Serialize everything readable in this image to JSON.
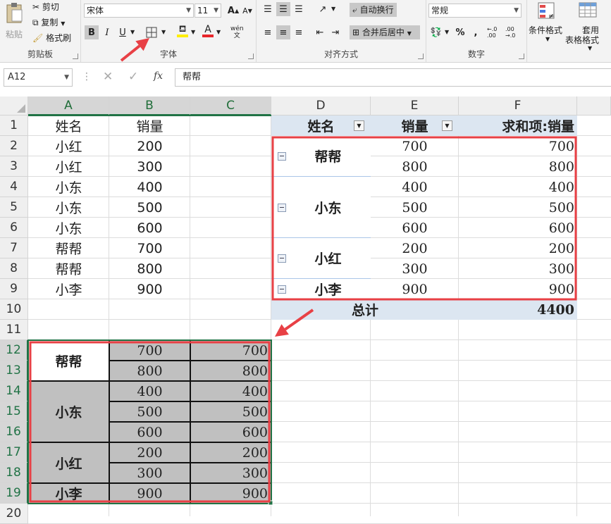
{
  "ribbon": {
    "clipboard": {
      "paste": "粘贴",
      "cut": "剪切",
      "copy": "复制",
      "format_painter": "格式刷",
      "label": "剪贴板"
    },
    "font": {
      "font_name": "宋体",
      "font_size": "11",
      "bold": "B",
      "italic": "I",
      "underline": "U",
      "grow": "A",
      "shrink": "A",
      "phonetic": "wén",
      "label": "字体"
    },
    "alignment": {
      "wrap": "自动换行",
      "merge": "合并后居中",
      "label": "对齐方式"
    },
    "number": {
      "format": "常规",
      "percent": "%",
      "comma": ",",
      "inc": "←.0 .00",
      "dec": ".00 →.0",
      "label": "数字"
    },
    "styles": {
      "conditional": "条件格式",
      "table": "套用",
      "table2": "表格格式"
    }
  },
  "formula_bar": {
    "name_box": "A12",
    "content": "帮帮"
  },
  "columns": [
    "A",
    "B",
    "C",
    "D",
    "E",
    "F"
  ],
  "rows": [
    "1",
    "2",
    "3",
    "4",
    "5",
    "6",
    "7",
    "8",
    "9",
    "10",
    "11",
    "12",
    "13",
    "14",
    "15",
    "16",
    "17",
    "18",
    "19",
    "20"
  ],
  "source_table": {
    "headers": [
      "姓名",
      "销量"
    ],
    "rows": [
      [
        "小红",
        "200"
      ],
      [
        "小红",
        "300"
      ],
      [
        "小东",
        "400"
      ],
      [
        "小东",
        "500"
      ],
      [
        "小东",
        "600"
      ],
      [
        "帮帮",
        "700"
      ],
      [
        "帮帮",
        "800"
      ],
      [
        "小李",
        "900"
      ]
    ]
  },
  "pivot": {
    "headers": [
      "姓名",
      "销量",
      "求和项:销量"
    ],
    "groups": [
      {
        "name": "帮帮",
        "values": [
          "700",
          "800"
        ],
        "sums": [
          "700",
          "800"
        ]
      },
      {
        "name": "小东",
        "values": [
          "400",
          "500",
          "600"
        ],
        "sums": [
          "400",
          "500",
          "600"
        ]
      },
      {
        "name": "小红",
        "values": [
          "200",
          "300"
        ],
        "sums": [
          "200",
          "300"
        ]
      },
      {
        "name": "小李",
        "values": [
          "900"
        ],
        "sums": [
          "900"
        ]
      }
    ],
    "total_label": "总计",
    "total_value": "4400"
  },
  "pasted": {
    "groups": [
      {
        "name": "帮帮",
        "values": [
          "700",
          "800"
        ],
        "sums": [
          "700",
          "800"
        ]
      },
      {
        "name": "小东",
        "values": [
          "400",
          "500",
          "600"
        ],
        "sums": [
          "400",
          "500",
          "600"
        ]
      },
      {
        "name": "小红",
        "values": [
          "200",
          "300"
        ],
        "sums": [
          "200",
          "300"
        ]
      },
      {
        "name": "小李",
        "values": [
          "900"
        ],
        "sums": [
          "900"
        ]
      }
    ]
  },
  "colors": {
    "accent": "#217346",
    "highlight": "#e84045",
    "pivot_header": "#dce6f1",
    "gray_fill": "#c0c0c0"
  }
}
